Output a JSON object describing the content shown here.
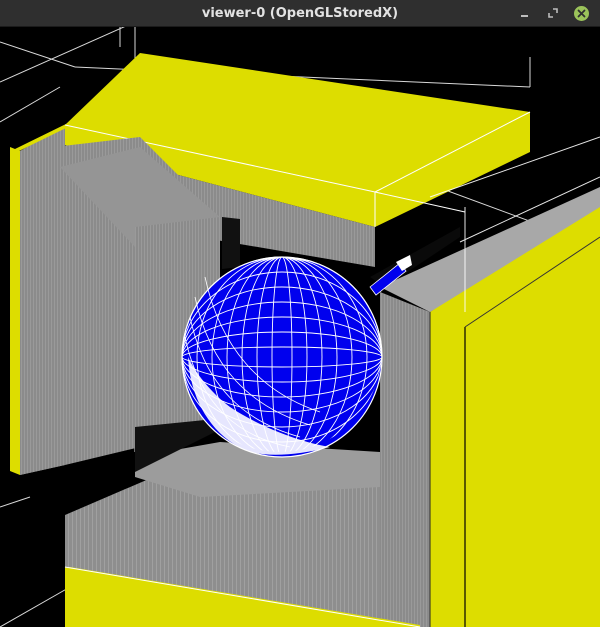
{
  "window": {
    "title": "viewer-0 (OpenGLStoredX)"
  },
  "controls": {
    "minimize_icon": "minimize-icon",
    "maximize_icon": "maximize-icon",
    "close_icon": "close-icon"
  },
  "scene": {
    "background": "#000000",
    "yoke_color": "#dddd00",
    "yoke_inner_color": "#8a8a8a",
    "sphere_color": "#0000ee",
    "wire_color": "#ffffff",
    "edge_color": "#ffffff"
  }
}
